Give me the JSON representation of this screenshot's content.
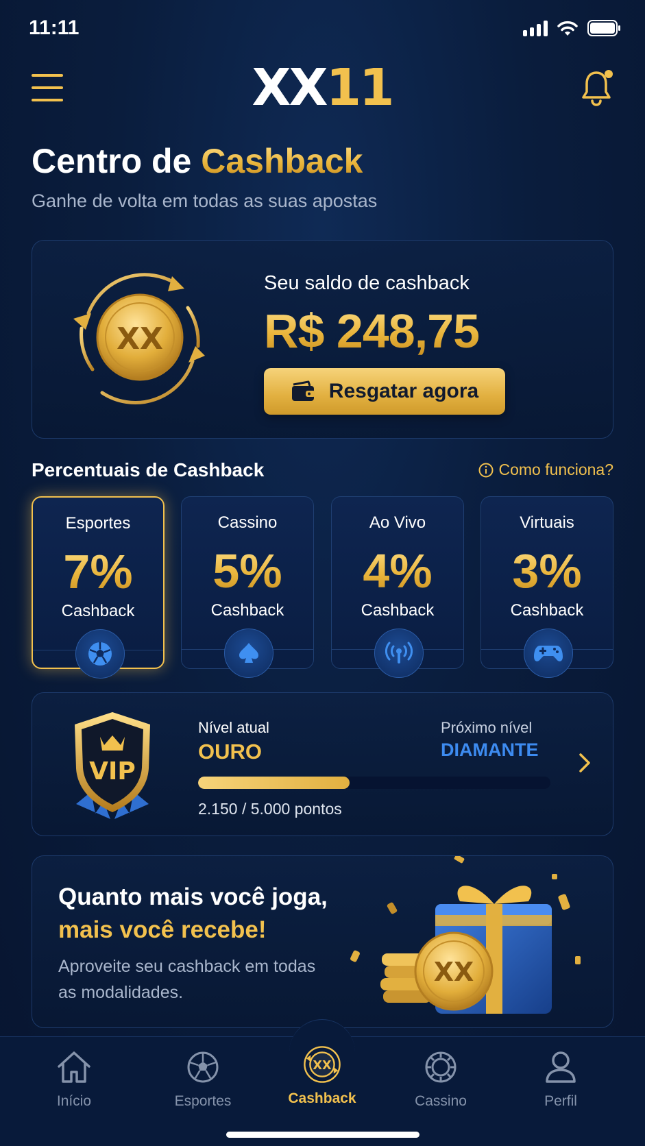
{
  "status_bar": {
    "time": "11:11"
  },
  "header": {
    "logo_left": "XX",
    "logo_right": "11"
  },
  "page": {
    "title_part1": "Centro de ",
    "title_part2": "Cashback",
    "subtitle": "Ganhe de volta em todas as suas apostas"
  },
  "balance": {
    "label": "Seu saldo de cashback",
    "value": "R$ 248,75",
    "coin_text": "XX",
    "redeem_label": "Resgatar agora"
  },
  "percentages": {
    "title": "Percentuais de Cashback",
    "help_link": "Como funciona?",
    "items": [
      {
        "category": "Esportes",
        "percent": "7%",
        "suffix": "Cashback",
        "icon": "soccer-ball-icon",
        "active": true
      },
      {
        "category": "Cassino",
        "percent": "5%",
        "suffix": "Cashback",
        "icon": "spade-icon",
        "active": false
      },
      {
        "category": "Ao Vivo",
        "percent": "4%",
        "suffix": "Cashback",
        "icon": "broadcast-icon",
        "active": false
      },
      {
        "category": "Virtuais",
        "percent": "3%",
        "suffix": "Cashback",
        "icon": "gamepad-icon",
        "active": false
      }
    ]
  },
  "vip": {
    "badge_text": "VIP",
    "current_label": "Nível atual",
    "current_level": "OURO",
    "next_label": "Próximo nível",
    "next_level": "DIAMANTE",
    "points_text": "2.150 / 5.000 pontos",
    "progress": 0.43
  },
  "promo": {
    "line1": "Quanto mais você joga,",
    "line2": "mais você recebe!",
    "text": "Aproveite seu cashback em todas as modalidades.",
    "coin_text": "XX"
  },
  "nav": {
    "items": [
      {
        "label": "Início",
        "icon": "home-icon"
      },
      {
        "label": "Esportes",
        "icon": "soccer-ball-icon"
      },
      {
        "label": "Cashback",
        "icon": "cashback-coin-icon",
        "active": true
      },
      {
        "label": "Cassino",
        "icon": "casino-chip-icon"
      },
      {
        "label": "Perfil",
        "icon": "user-icon"
      }
    ]
  },
  "colors": {
    "gold": "#f2c14e",
    "blue_accent": "#3d8bf0",
    "background": "#0a1d3d"
  }
}
